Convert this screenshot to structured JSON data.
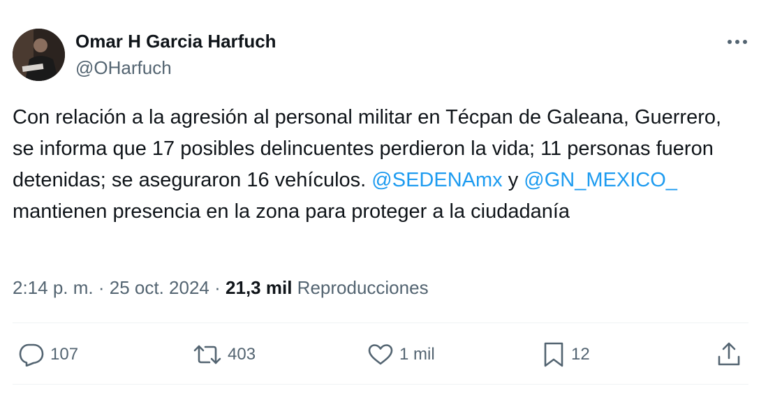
{
  "author": {
    "name": "Omar H Garcia Harfuch",
    "handle": "@OHarfuch"
  },
  "tweet": {
    "text_before_mention1": "Con relación a la agresión al personal militar en Técpan de Galeana, Guerrero, se informa que 17 posibles delincuentes perdieron la vida; 11 personas fueron detenidas; se aseguraron 16 vehículos. ",
    "mention1": "@SEDENAmx",
    "text_between": " y ",
    "mention2": "@GN_MEXICO_",
    "text_after": " mantienen presencia en la zona para proteger a la ciudadanía"
  },
  "meta": {
    "time": "2:14 p. m.",
    "separator": "·",
    "date": "25 oct. 2024",
    "views_count": "21,3 mil",
    "views_label": "Reproducciones"
  },
  "actions": {
    "replies": "107",
    "reposts": "403",
    "likes": "1 mil",
    "bookmarks": "12"
  },
  "icons": {
    "more": "more-dots-icon",
    "reply": "reply-icon",
    "repost": "repost-icon",
    "like": "heart-icon",
    "bookmark": "bookmark-icon",
    "share": "share-icon"
  },
  "colors": {
    "text": "#0f1419",
    "secondary": "#536471",
    "link": "#1d9bf0",
    "divider": "#eff3f4"
  }
}
